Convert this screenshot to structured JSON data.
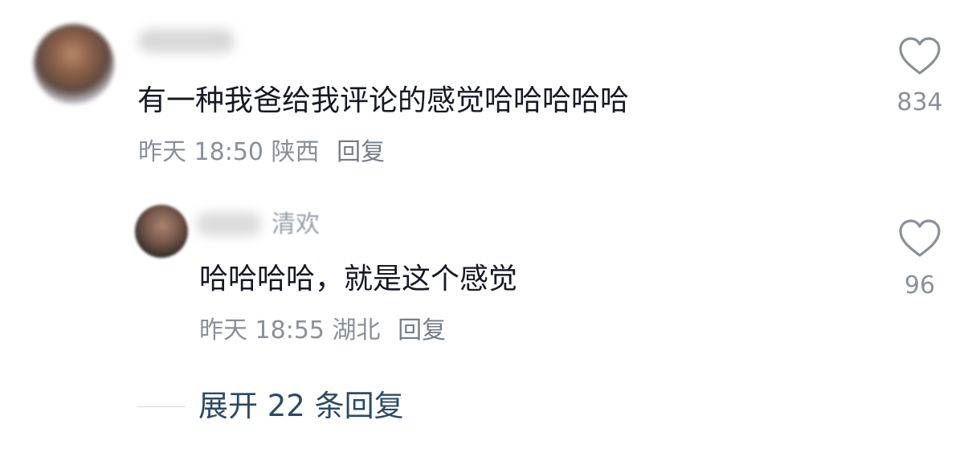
{
  "comments": [
    {
      "text": "有一种我爸给我评论的感觉哈哈哈哈哈",
      "time": "昨天 18:50",
      "location": "陕西",
      "reply_label": "回复",
      "likes": "834"
    }
  ],
  "reply": {
    "username_visible": "清欢",
    "text": "哈哈哈哈，就是这个感觉",
    "time": "昨天 18:55",
    "location": "湖北",
    "reply_label": "回复",
    "likes": "96"
  },
  "expand_replies": "展开 22 条回复",
  "icons": {
    "like": "heart-outline-icon"
  },
  "colors": {
    "text": "#161823",
    "meta": "#8a8f99",
    "link": "#2b4a66"
  }
}
